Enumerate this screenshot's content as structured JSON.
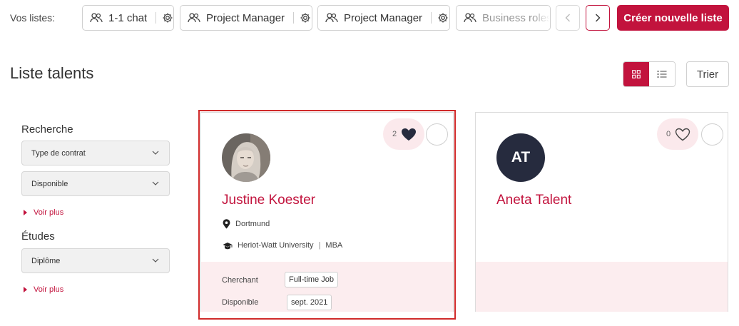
{
  "listbar": {
    "label": "Vos listes:",
    "lists": [
      {
        "name": "1-1 chat"
      },
      {
        "name": "Project Manager"
      },
      {
        "name": "Project Manager"
      },
      {
        "name": "Business roles"
      }
    ],
    "create_label": "Créer nouvelle liste"
  },
  "page": {
    "title": "Liste talents",
    "sort_label": "Trier",
    "view_mode": "grid"
  },
  "filters": {
    "search_heading": "Recherche",
    "contract_select": "Type de contrat",
    "availability_select": "Disponible",
    "see_more_1": "Voir plus",
    "studies_heading": "Études",
    "degree_select": "Diplôme",
    "see_more_2": "Voir plus"
  },
  "candidates": [
    {
      "name": "Justine Koester",
      "likes": "2",
      "liked": true,
      "location": "Dortmund",
      "school": "Heriot-Watt University",
      "degree": "MBA",
      "seeking_label": "Cherchant",
      "seeking_value": "Full-time Job",
      "available_label": "Disponible",
      "available_value": "sept. 2021"
    },
    {
      "name": "Aneta Talent",
      "initials": "AT",
      "likes": "0",
      "liked": false
    }
  ],
  "colors": {
    "brand": "#c2133d",
    "avatar_dark": "#262b3e",
    "card_tint": "#fcedef",
    "highlight": "#d02a2a"
  }
}
